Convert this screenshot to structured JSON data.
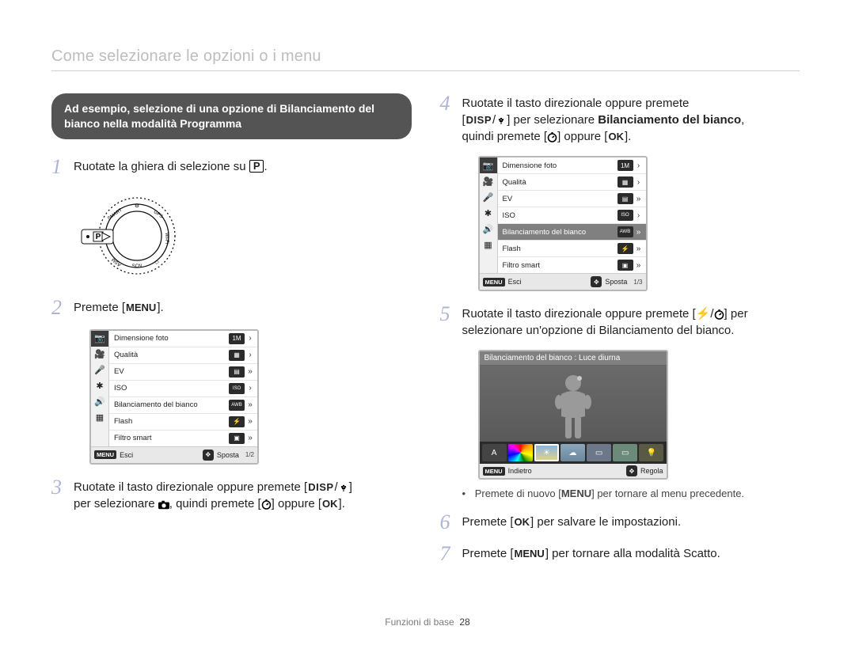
{
  "header": {
    "title": "Come selezionare le opzioni o i menu"
  },
  "pill": "Ad esempio, selezione di una opzione di Bilanciamento del bianco nella modalità Programma",
  "steps": {
    "s1": {
      "num": "1",
      "text": "Ruotate la ghiera di selezione su "
    },
    "s2": {
      "num": "2",
      "pre": "Premete [",
      "btn": "MENU",
      "post": "]."
    },
    "s3": {
      "num": "3",
      "l1_pre": "Ruotate il tasto direzionale oppure premete [",
      "l1_disp": "DISP",
      "l2_pre": "per selezionare ",
      "l2_mid": ", quindi premete [",
      "l2_post": "] oppure [",
      "l2_ok": "OK",
      "l2_end": "]."
    },
    "s4": {
      "num": "4",
      "l1": "Ruotate il tasto direzionale oppure premete",
      "l2_pre": "[",
      "l2_disp": "DISP",
      "l2_mid": "] per selezionare ",
      "l2_bold": "Bilanciamento del bianco",
      "l3_pre": "quindi premete [",
      "l3_mid": "] oppure [",
      "l3_ok": "OK",
      "l3_end": "]."
    },
    "s5": {
      "num": "5",
      "l1_pre": "Ruotate il tasto direzionale oppure premete [",
      "l1_post": "] per",
      "l2": "selezionare un'opzione di Bilanciamento del bianco."
    },
    "s6": {
      "num": "6",
      "pre": "Premete [",
      "ok": "OK",
      "post": "] per salvare le impostazioni."
    },
    "s7": {
      "num": "7",
      "pre": "Premete [",
      "menu": "MENU",
      "post": "] per tornare alla modalità Scatto."
    }
  },
  "bullet": {
    "pre": "Premete di nuovo [",
    "menu": "MENU",
    "post": "] per tornare al menu precedente."
  },
  "lcd": {
    "side_icons": [
      "camera",
      "video",
      "mic",
      "aperture",
      "speaker",
      "grid"
    ],
    "rows": [
      {
        "label": "Dimensione foto",
        "icon": "1M"
      },
      {
        "label": "Qualità",
        "icon": "▦"
      },
      {
        "label": "EV",
        "icon": "▤"
      },
      {
        "label": "ISO",
        "icon": "ISO"
      },
      {
        "label": "Bilanciamento del bianco",
        "icon": "AWB"
      },
      {
        "label": "Flash",
        "icon": "⚡"
      },
      {
        "label": "Filtro smart",
        "icon": "▣"
      }
    ],
    "footer": {
      "menu": "MENU",
      "esci": "Esci",
      "sposta": "Sposta"
    }
  },
  "lcd_left_page": "1/2",
  "lcd_right_page": "1/3",
  "lcd_right_selected_index": 4,
  "wb": {
    "title": "Bilanciamento del bianco : Luce diurna",
    "footer": {
      "menu": "MENU",
      "indietro": "Indietro",
      "regola": "Regola"
    }
  },
  "footer": {
    "section": "Funzioni di base",
    "page": "28"
  }
}
